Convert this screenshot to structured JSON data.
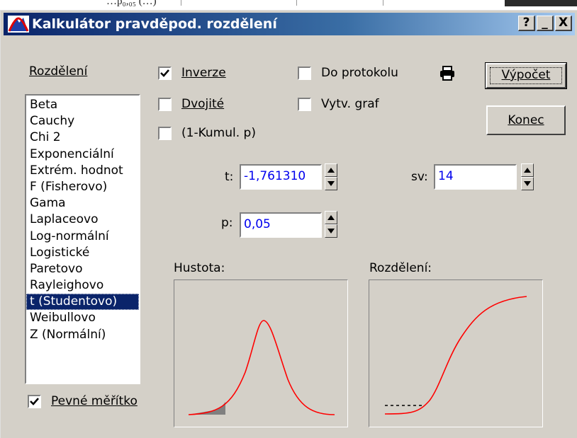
{
  "backdrop": {
    "fragment": "…p₀,₀₅ (…)"
  },
  "window": {
    "title": "Kalkulátor pravděpod. rozdělení",
    "help_label": "?",
    "minimize_label": "_",
    "close_label": "X"
  },
  "distributions": {
    "label": "Rozdělení",
    "items": [
      "Beta",
      "Cauchy",
      "Chi 2",
      "Exponenciální",
      "Extrém. hodnot",
      "F (Fisherovo)",
      "Gama",
      "Laplaceovo",
      "Log-normální",
      "Logistické",
      "Paretovo",
      "Rayleighovo",
      "t (Studentovo)",
      "Weibullovo",
      "Z (Normální)"
    ],
    "selected": "t (Studentovo)"
  },
  "options": {
    "inverze": {
      "label": "Inverze",
      "checked": true
    },
    "dvojite": {
      "label": "Dvojité",
      "checked": false
    },
    "kumul": {
      "label": "(1-Kumul. p)",
      "checked": false
    },
    "protokol": {
      "label": "Do protokolu",
      "checked": false
    },
    "graf": {
      "label": "Vytv. graf",
      "checked": false
    },
    "pevne": {
      "label": "Pevné měřítko",
      "checked": true
    }
  },
  "buttons": {
    "vypocet": "Výpočet",
    "konec": "Konec"
  },
  "fields": {
    "t": {
      "label": "t:",
      "value": "-1,761310"
    },
    "sv": {
      "label": "sv:",
      "value": "14"
    },
    "p": {
      "label": "p:",
      "value": "0,05"
    }
  },
  "graphs": {
    "density_label": "Hustota:",
    "cdf_label": "Rozdělení:"
  },
  "icons": {
    "app": "distribution-app-icon",
    "print": "printer-icon"
  },
  "colors": {
    "titlebar_start": "#0a246a",
    "titlebar_end": "#a6caf0",
    "dialog_bg": "#d4d0c8",
    "curve": "#ff0000",
    "value_text": "#0000ee",
    "selection": "#0a246a"
  }
}
